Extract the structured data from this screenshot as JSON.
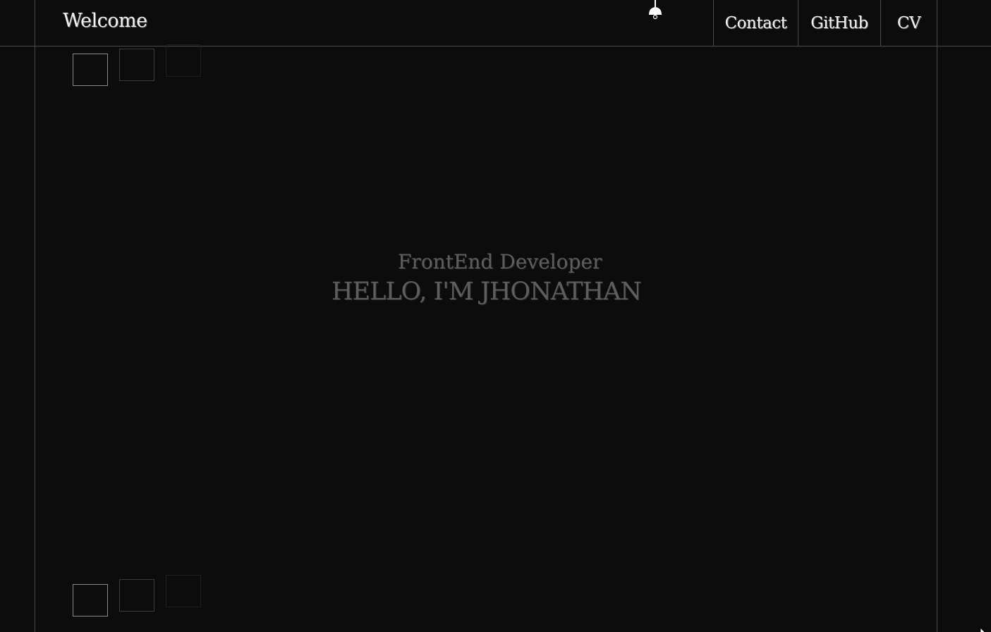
{
  "header": {
    "brand": "Welcome",
    "nav": {
      "contact": "Contact",
      "github": "GitHub",
      "cv": "CV"
    },
    "lamp_icon": "lamp-icon"
  },
  "hero": {
    "subtitle": "FrontEnd Developer",
    "title": "HELLO, I'M JHONATHAN"
  },
  "colors": {
    "background": "#0c0c0c",
    "text_light": "#f0f0f0",
    "text_dim": "#5e5e5e",
    "lines": "#4a4a4a"
  }
}
